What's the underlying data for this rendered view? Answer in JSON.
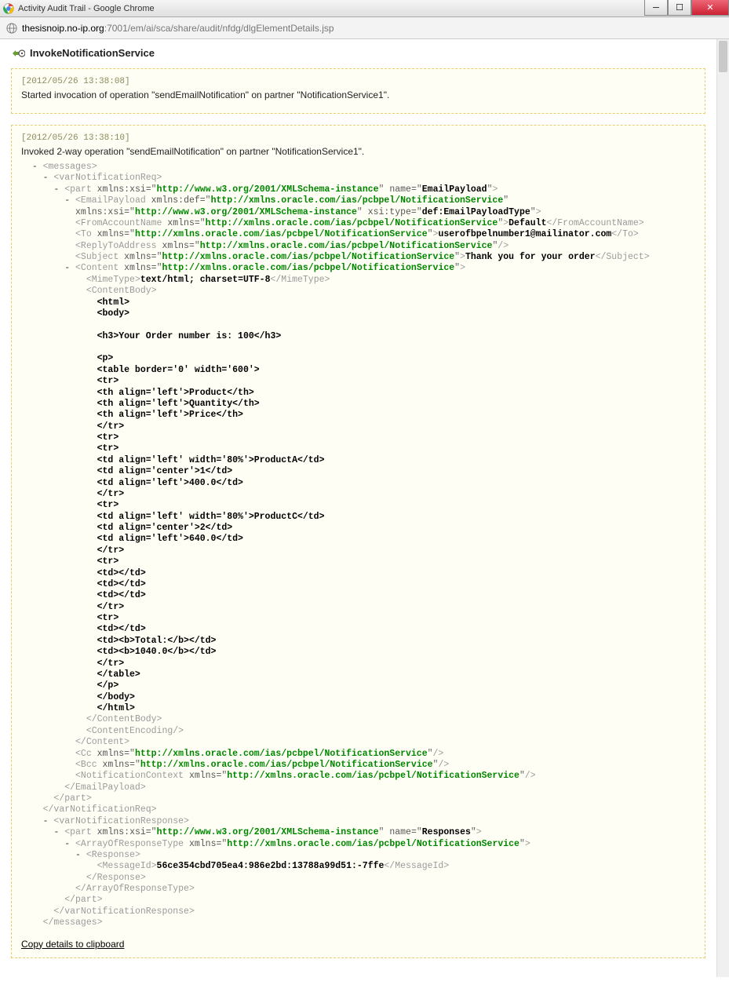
{
  "window": {
    "title": "Activity Audit Trail - Google Chrome"
  },
  "address": {
    "host": "thesisnoip.no-ip.org",
    "port": ":7001",
    "path": "/em/ai/sca/share/audit/nfdg/dlgElementDetails.jsp"
  },
  "page": {
    "heading": "InvokeNotificationService"
  },
  "block1": {
    "timestamp": "[2012/05/26 13:38:08]",
    "message": "Started invocation of operation \"sendEmailNotification\" on partner \"NotificationService1\"."
  },
  "block2": {
    "timestamp": "[2012/05/26 13:38:10]",
    "message": "Invoked 2-way operation \"sendEmailNotification\" on partner \"NotificationService1\".",
    "xml": {
      "ns_xsi": "http://www.w3.org/2001/XMLSchema-instance",
      "ns_notif": "http://xmlns.oracle.com/ias/pcbpel/NotificationService",
      "part1_name": "EmailPayload",
      "xsi_type": "def:EmailPayloadType",
      "from_account": "Default",
      "to": "userofbpelnumber1@mailinator.com",
      "subject": "Thank you for your order",
      "mime_type": "text/html; charset=UTF-8",
      "body_lines": [
        "<html>",
        "<body>",
        "",
        "<h3>Your Order number is: 100</h3>",
        "",
        "<p>",
        "<table border='0' width='600'>",
        "<tr>",
        "<th align='left'>Product</th>",
        "<th align='left'>Quantity</th>",
        "<th align='left'>Price</th>",
        "</tr>",
        "<tr>",
        "<tr>",
        "<td align='left' width='80%'>ProductA</td>",
        "<td align='center'>1</td>",
        "<td align='left'>400.0</td>",
        "</tr>",
        "<tr>",
        "<td align='left' width='80%'>ProductC</td>",
        "<td align='center'>2</td>",
        "<td align='left'>640.0</td>",
        "</tr>",
        "<tr>",
        "<td></td>",
        "<td></td>",
        "<td></td>",
        "</tr>",
        "<tr>",
        "<td></td>",
        "<td><b>Total:</b></td>",
        "<td><b>1040.0</b></td>",
        "</tr>",
        "</table>",
        "</p>",
        "</body>",
        "</html>"
      ],
      "part2_name": "Responses",
      "message_id": "56ce354cbd705ea4:986e2bd:13788a99d51:-7ffe"
    },
    "copy_link": "Copy details to clipboard"
  }
}
